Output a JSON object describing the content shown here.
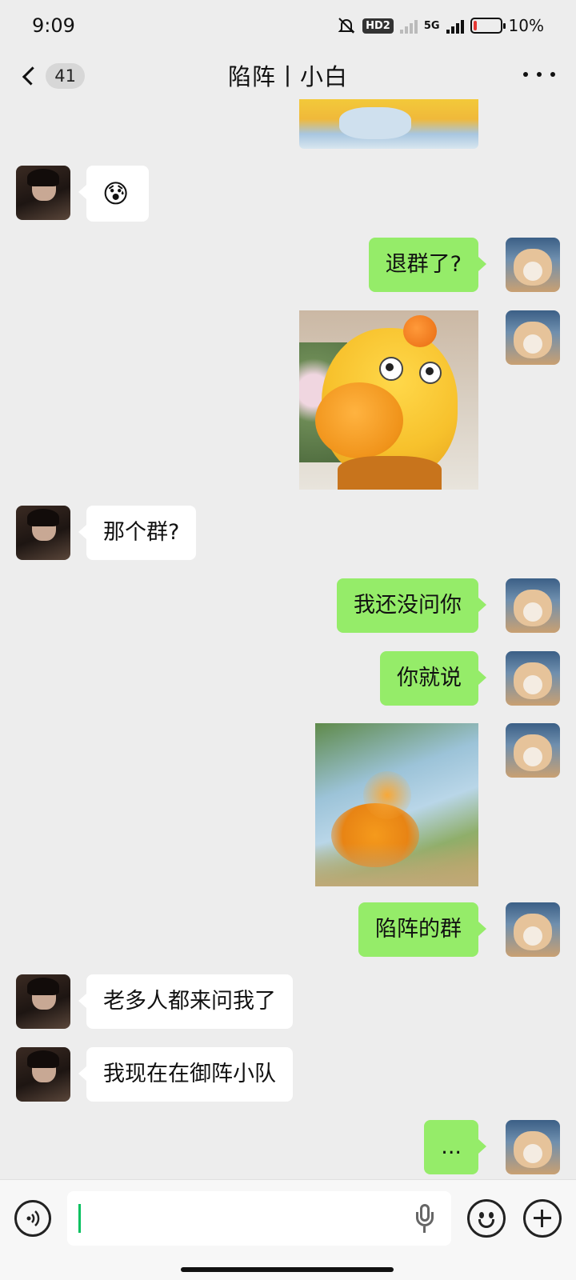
{
  "status_bar": {
    "time": "9:09",
    "hd_label": "HD2",
    "network_label": "5G",
    "battery_text": "10%"
  },
  "header": {
    "unread_count": "41",
    "title": "陷阵丨小白"
  },
  "messages": [
    {
      "side": "out",
      "type": "sticker",
      "description": "partial-sticker"
    },
    {
      "side": "in",
      "type": "emoji",
      "text": "😰"
    },
    {
      "side": "out",
      "type": "text",
      "text": "退群了?"
    },
    {
      "side": "out",
      "type": "sticker",
      "description": "yellow-hippo-sticker"
    },
    {
      "side": "in",
      "type": "text",
      "text": "那个群?"
    },
    {
      "side": "out",
      "type": "text",
      "text": "我还没问你"
    },
    {
      "side": "out",
      "type": "text",
      "text": "你就说"
    },
    {
      "side": "out",
      "type": "sticker",
      "description": "blurred-sticker"
    },
    {
      "side": "out",
      "type": "text",
      "text": "陷阵的群"
    },
    {
      "side": "in",
      "type": "text",
      "text": "老多人都来问我了"
    },
    {
      "side": "in",
      "type": "text",
      "text": "我现在在御阵小队"
    },
    {
      "side": "out",
      "type": "text",
      "text": "..."
    }
  ],
  "colors": {
    "outgoing_bubble": "#95ec69",
    "incoming_bubble": "#ffffff",
    "background": "#ededed",
    "caret": "#07c160"
  },
  "icons": {
    "back": "chevron-left-icon",
    "more": "more-dots-icon",
    "voice": "voice-icon",
    "mic": "mic-icon",
    "emoji": "emoji-icon",
    "plus": "plus-icon"
  }
}
